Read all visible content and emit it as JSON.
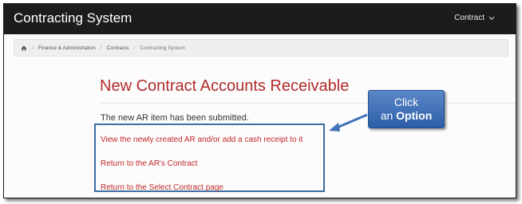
{
  "header": {
    "app_title": "Contracting System",
    "menu_label": "Contract"
  },
  "breadcrumb": {
    "home_icon": "home-icon",
    "items": [
      "Finance & Administration",
      "Contracts",
      "Contracting System"
    ],
    "separator": "/"
  },
  "main": {
    "title": "New Contract Accounts Receivable",
    "message": "The new AR item has been submitted.",
    "options": [
      "View the newly created AR and/or add a cash receipt to it",
      "Return to the AR's Contract",
      "Return to the Select Contract page"
    ]
  },
  "callout": {
    "line1": "Click",
    "line2_prefix": "an",
    "line2_bold": "Option"
  },
  "colors": {
    "header_bg": "#1c1c1c",
    "title_red": "#b22a2a",
    "link_red": "#c0282b",
    "box_blue": "#3d6ea5",
    "callout_blue": "#2b5ea8"
  }
}
